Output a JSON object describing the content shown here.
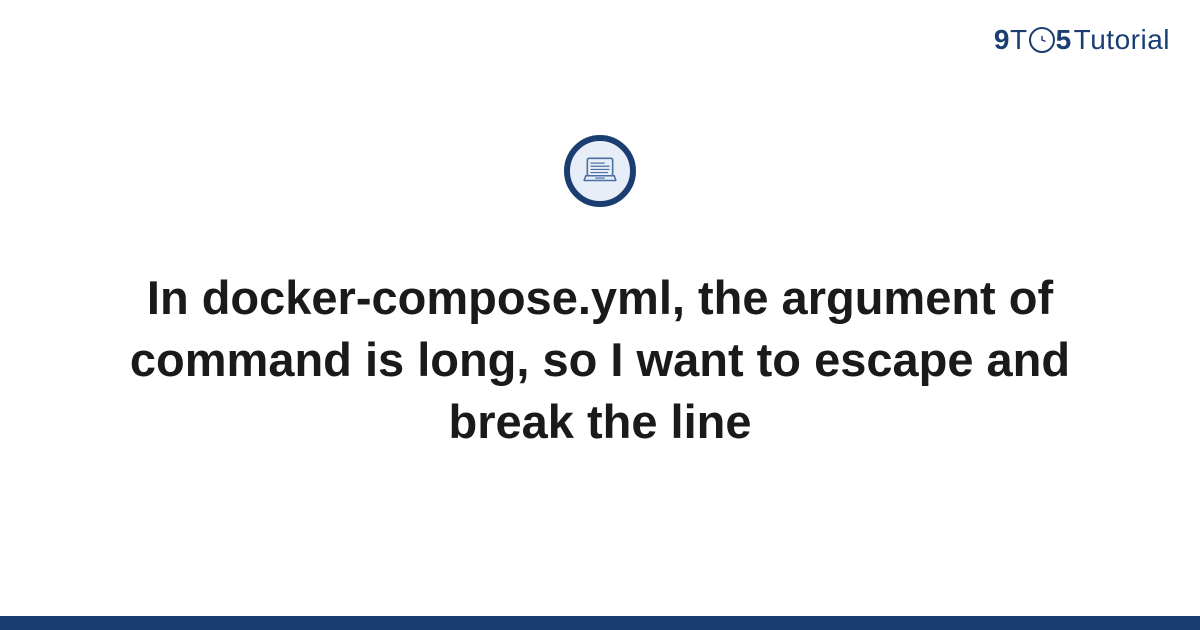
{
  "logo": {
    "nine": "9",
    "t": "T",
    "five": "5",
    "tutorial": "Tutorial"
  },
  "headline": "In docker-compose.yml, the argument of command is long, so I want to escape and break the line",
  "colors": {
    "brand": "#1a3e72",
    "badge_bg": "#e8eef7"
  }
}
